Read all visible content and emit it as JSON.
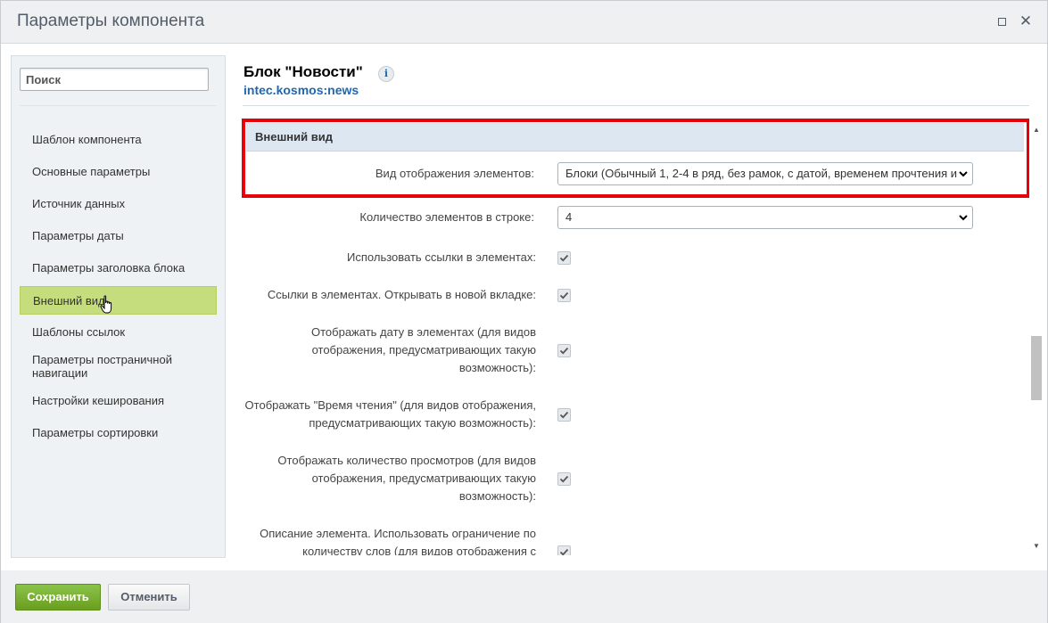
{
  "dialog": {
    "title": "Параметры компонента",
    "maximize_icon": "maximize-icon",
    "close_icon": "close-icon",
    "close_glyph": "✕"
  },
  "sidebar": {
    "search_placeholder": "Поиск",
    "items": [
      {
        "label": "Шаблон компонента"
      },
      {
        "label": "Основные параметры"
      },
      {
        "label": "Источник данных"
      },
      {
        "label": "Параметры даты"
      },
      {
        "label": "Параметры заголовка блока"
      },
      {
        "label": "Внешний вид",
        "active": true
      },
      {
        "label": "Шаблоны ссылок"
      },
      {
        "label": "Параметры постраничной навигации"
      },
      {
        "label": "Настройки кеширования"
      },
      {
        "label": "Параметры сортировки"
      }
    ]
  },
  "content": {
    "title": "Блок \"Новости\"",
    "component_code": "intec.kosmos:news",
    "info_glyph": "i",
    "section_title": "Внешний вид",
    "fields": [
      {
        "label": "Вид отображения элементов:",
        "type": "select",
        "value": "Блоки (Обычный 1, 2-4 в ряд, без рамок, с датой, временем прочтения и"
      },
      {
        "label": "Количество элементов в строке:",
        "type": "select",
        "value": "4"
      },
      {
        "label": "Использовать ссылки в элементах:",
        "type": "checkbox",
        "checked": true
      },
      {
        "label": "Ссылки в элементах. Открывать в новой вкладке:",
        "type": "checkbox",
        "checked": true
      },
      {
        "label": "Отображать дату в элементах (для видов отображения, предусматривающих такую возможность):",
        "type": "checkbox",
        "checked": true
      },
      {
        "label": "Отображать \"Время чтения\" (для видов отображения, предусматривающих такую возможность):",
        "type": "checkbox",
        "checked": true
      },
      {
        "label": "Отображать количество просмотров (для видов отображения, предусматривающих такую возможность):",
        "type": "checkbox",
        "checked": true
      },
      {
        "label": "Описание элемента. Использовать ограничение по количеству слов (для видов отображения с",
        "type": "checkbox",
        "checked": true
      }
    ]
  },
  "footer": {
    "save_label": "Сохранить",
    "cancel_label": "Отменить"
  },
  "colors": {
    "accent_green": "#8bc34a",
    "active_item": "#c6dd7d",
    "highlight_red": "#e8000b",
    "link_blue": "#2067b0"
  }
}
